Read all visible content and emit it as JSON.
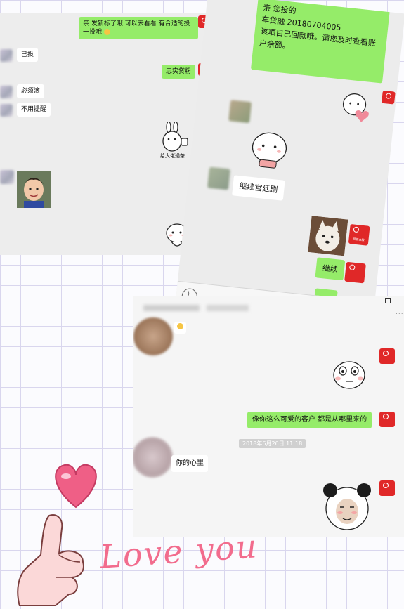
{
  "shot1": {
    "messages": {
      "m1": "亲 发新标了哦 可以去看看 有合适的投一投哦",
      "m2": "已投",
      "m3": "忠实贷粉",
      "m4": "必须滴",
      "m5": "不用提醒",
      "sticker_caption": "给大佬递茶"
    }
  },
  "shot2": {
    "notice_lines": [
      "亲 您投的",
      "车贷融 20180704005",
      "该项目已回款哦。请您及时查看账",
      "户余额。"
    ],
    "reply1": "继续宫廷剧",
    "reply2": "继续",
    "app_badge": "营首金服"
  },
  "shot3": {
    "msg1": "像你这么可爱的客户 都是从哪里来的",
    "timestamp": "2018年6月26日 11:18",
    "msg2": "你的心里"
  },
  "decor": {
    "text": "Love you"
  },
  "colors": {
    "green_bubble": "#95ec69",
    "app_red": "#e02828"
  }
}
